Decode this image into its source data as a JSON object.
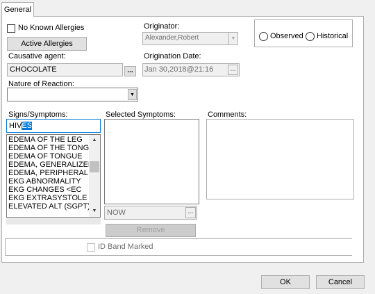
{
  "tab": {
    "label": "General"
  },
  "no_known_allergies": {
    "label": "No Known Allergies",
    "checked": false
  },
  "active_allergies_button": "Active Allergies",
  "causative_agent": {
    "label": "Causative agent:",
    "value": "CHOCOLATE",
    "ellipsis": "..."
  },
  "originator": {
    "label": "Originator:",
    "value": "Alexander,Robert"
  },
  "origination_date": {
    "label": "Origination Date:",
    "value": "Jan 30,2018@21:16",
    "ellipsis": "..."
  },
  "observation_type": {
    "observed": "Observed",
    "historical": "Historical"
  },
  "nature_of_reaction": {
    "label": "Nature of Reaction:",
    "value": ""
  },
  "signs_symptoms": {
    "label": "Signs/Symptoms:",
    "search_value_prefix": "HIV",
    "search_value_selected": "ES",
    "items": [
      "EDEMA OF THE LEG",
      "EDEMA OF THE TONGUE",
      "EDEMA OF TONGUE",
      "EDEMA, GENERALIZED",
      "EDEMA, PERIPHERAL",
      "EKG ABNORMALITY",
      "EKG CHANGES      <EC",
      "EKG EXTRASYSTOLE",
      "ELEVATED ALT (SGPT)"
    ]
  },
  "selected_symptoms": {
    "label": "Selected Symptoms:",
    "date_value": "NOW",
    "ellipsis": "...",
    "remove_button": "Remove"
  },
  "comments": {
    "label": "Comments:",
    "value": ""
  },
  "id_band": {
    "label": "ID Band Marked",
    "checked": false
  },
  "footer": {
    "ok": "OK",
    "cancel": "Cancel"
  }
}
